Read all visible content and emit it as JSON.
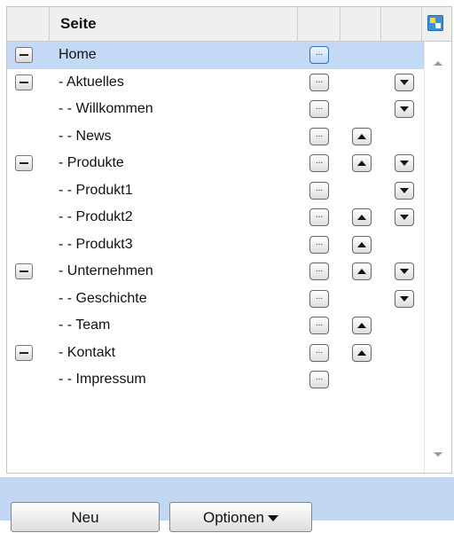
{
  "header": {
    "column_title": "Seite"
  },
  "rows": [
    {
      "name": "Home",
      "toggle": true,
      "edit_label": "...",
      "up": false,
      "down": false,
      "selected": true
    },
    {
      "name": "- Aktuelles",
      "toggle": true,
      "edit_label": "...",
      "up": false,
      "down": true
    },
    {
      "name": "- - Willkommen",
      "toggle": false,
      "edit_label": "...",
      "up": false,
      "down": true
    },
    {
      "name": "- - News",
      "toggle": false,
      "edit_label": "...",
      "up": true,
      "down": false
    },
    {
      "name": "- Produkte",
      "toggle": true,
      "edit_label": "...",
      "up": true,
      "down": true
    },
    {
      "name": "- - Produkt1",
      "toggle": false,
      "edit_label": "...",
      "up": false,
      "down": true
    },
    {
      "name": "- - Produkt2",
      "toggle": false,
      "edit_label": "...",
      "up": true,
      "down": true
    },
    {
      "name": "- - Produkt3",
      "toggle": false,
      "edit_label": "...",
      "up": true,
      "down": false
    },
    {
      "name": "- Unternehmen",
      "toggle": true,
      "edit_label": "...",
      "up": true,
      "down": true
    },
    {
      "name": "- - Geschichte",
      "toggle": false,
      "edit_label": "...",
      "up": false,
      "down": true
    },
    {
      "name": "- - Team",
      "toggle": false,
      "edit_label": "...",
      "up": true,
      "down": false
    },
    {
      "name": "- Kontakt",
      "toggle": true,
      "edit_label": "...",
      "up": true,
      "down": false
    },
    {
      "name": "- - Impressum",
      "toggle": false,
      "edit_label": "...",
      "up": false,
      "down": false
    }
  ],
  "footer": {
    "new_label": "Neu",
    "options_label": "Optionen"
  },
  "colors": {
    "selected_row": "#c3d9f5",
    "footer_bg": "#c2d8f2",
    "header_bg": "#efefef"
  }
}
